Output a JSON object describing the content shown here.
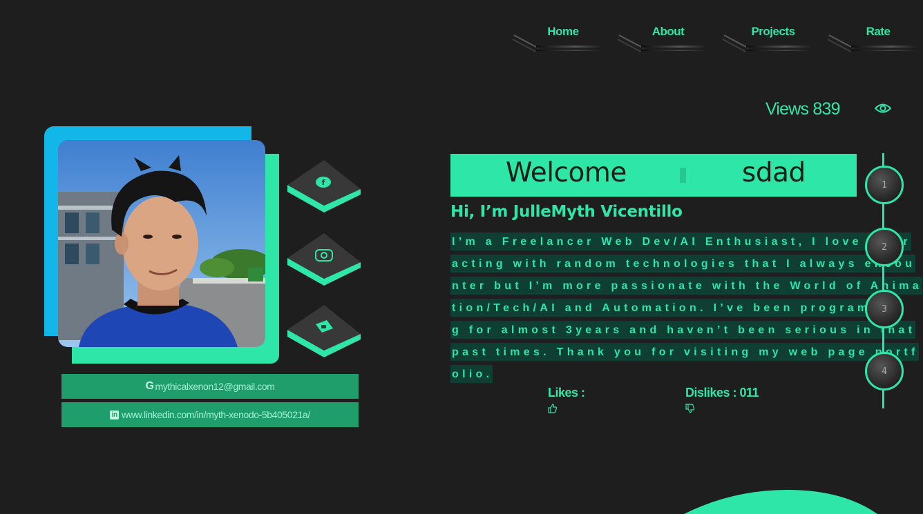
{
  "nav": {
    "items": [
      {
        "label": "Home"
      },
      {
        "label": "About"
      },
      {
        "label": "Projects"
      },
      {
        "label": "Rate"
      }
    ]
  },
  "views": {
    "label": "Views 839"
  },
  "welcome": {
    "word1": "Welcome",
    "word2": "sdad"
  },
  "greeting": "Hi, I’m JulleMyth Vicentillo",
  "bio_lines": [
    "I’m a Freelancer Web Dev/AI Enthusiast, I love inter",
    "acting with random technologies that I always encou",
    "nter but I’m more passionate with the World of Anima",
    "tion/Tech/AI and Automation. I’ve been programmin",
    "g for almost 3years and haven’t been serious in that",
    "past times. Thank you for visiting my web page portf",
    "olio."
  ],
  "reactions": {
    "likes_label": "Likes :",
    "dislikes_label": "Dislikes : 011"
  },
  "contacts": {
    "email": {
      "icon": "G",
      "text": "mythicalxenon12@gmail.com"
    },
    "linkedin": {
      "icon": "in",
      "text": "www.linkedin.com/in/myth-xenodo-5b405021a/"
    }
  },
  "timeline": [
    "1",
    "2",
    "3",
    "4"
  ],
  "social": [
    "facebook-icon",
    "instagram-icon",
    "chat-icon"
  ],
  "colors": {
    "accent": "#2ee6a8",
    "blue": "#12b6e8",
    "background": "#1e1e1e"
  }
}
